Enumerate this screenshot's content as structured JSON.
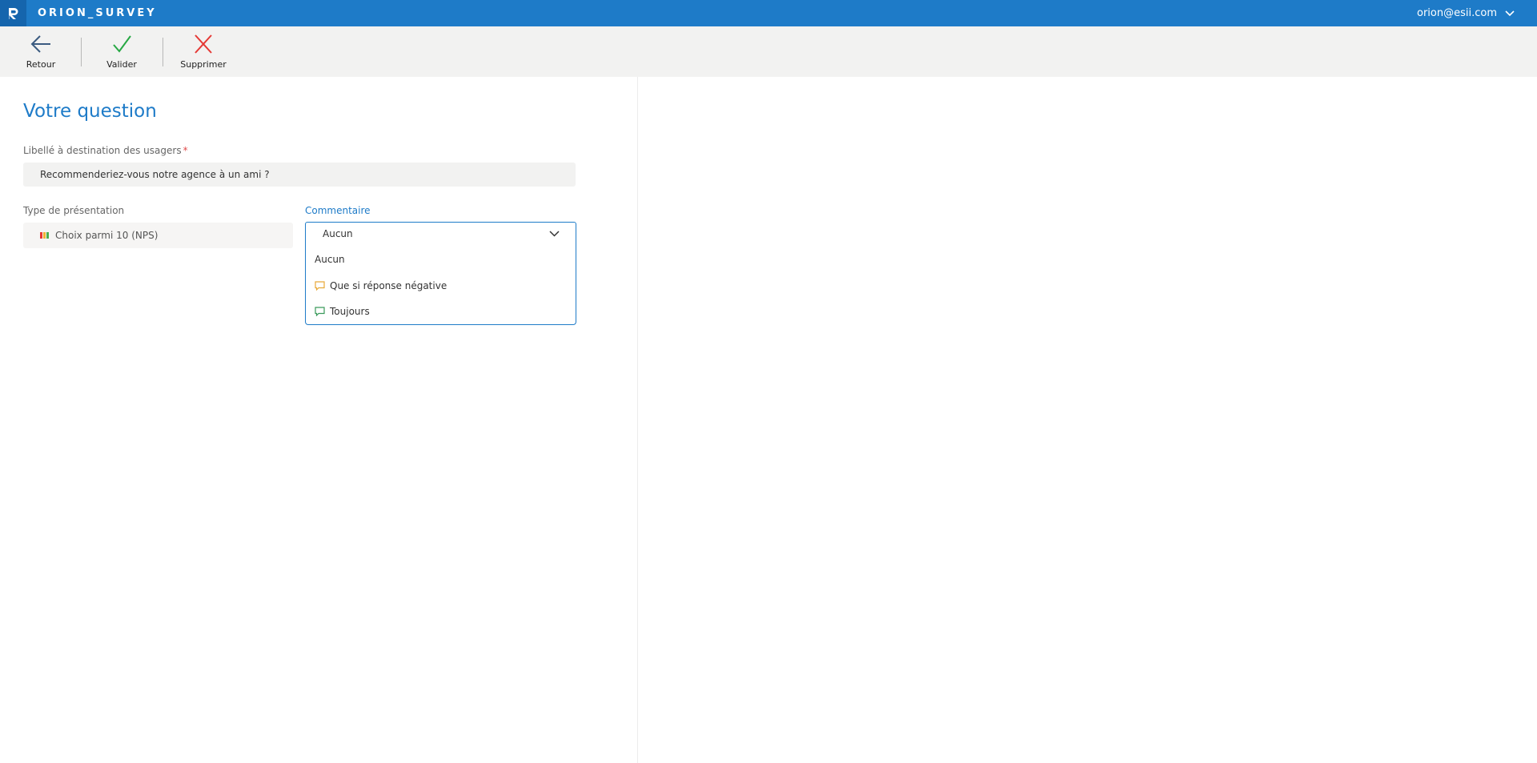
{
  "app": {
    "title": "ORION_SURVEY",
    "user_email": "orion@esii.com"
  },
  "toolbar": {
    "back_label": "Retour",
    "validate_label": "Valider",
    "delete_label": "Supprimer"
  },
  "form": {
    "heading": "Votre question",
    "label_field": {
      "label": "Libellé à destination des usagers",
      "required_mark": "*",
      "value": "Recommenderiez-vous notre agence à un ami ?"
    },
    "presentation": {
      "label": "Type de présentation",
      "value": "Choix parmi 10 (NPS)"
    },
    "comment": {
      "label": "Commentaire",
      "selected": "Aucun",
      "options": [
        {
          "label": "Aucun",
          "icon": "none"
        },
        {
          "label": "Que si réponse négative",
          "icon": "comment-orange-icon"
        },
        {
          "label": "Toujours",
          "icon": "comment-green-icon"
        }
      ]
    }
  },
  "colors": {
    "accent": "#1e7bc8",
    "validate": "#27a844",
    "delete": "#e53935",
    "negative_bubble": "#e8a93a",
    "always_bubble": "#3a9a5b"
  }
}
